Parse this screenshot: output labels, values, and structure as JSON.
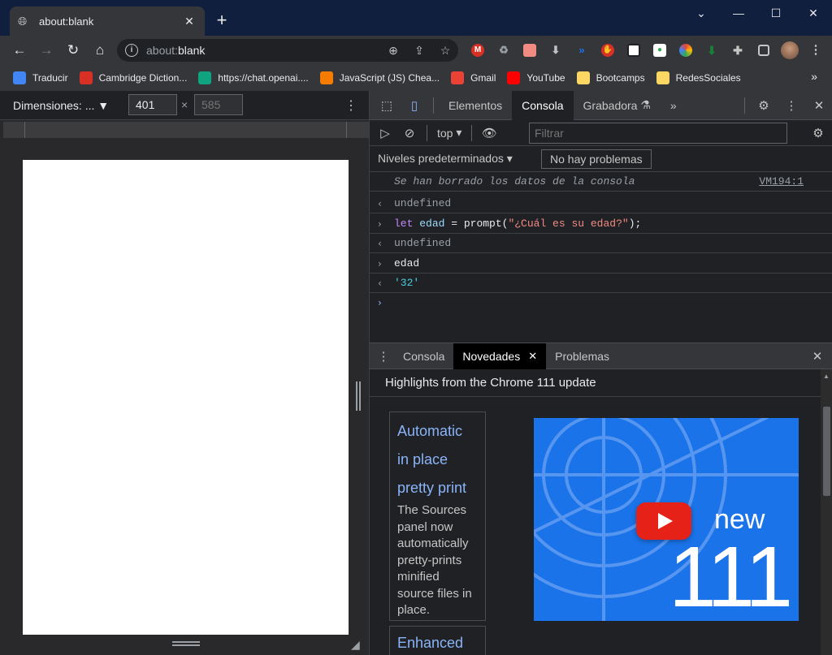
{
  "browser": {
    "tab": {
      "title": "about:blank"
    },
    "omnibox": {
      "url_prefix": "about:",
      "url_host": "blank"
    },
    "bookmarks": [
      {
        "label": "Traducir",
        "icon": "google-translate-icon",
        "color": "#4285f4"
      },
      {
        "label": "Cambridge Diction...",
        "icon": "cambridge-icon",
        "color": "#d93025"
      },
      {
        "label": "https://chat.openai....",
        "icon": "openai-icon",
        "color": "#10a37f"
      },
      {
        "label": "JavaScript (JS) Chea...",
        "icon": "js-cheatsheet-icon",
        "color": "#f57c00"
      },
      {
        "label": "Gmail",
        "icon": "gmail-icon",
        "color": "#ea4335"
      },
      {
        "label": "YouTube",
        "icon": "youtube-icon",
        "color": "#ff0000"
      },
      {
        "label": "Bootcamps",
        "icon": "folder-icon",
        "color": "#fdd663"
      },
      {
        "label": "RedesSociales",
        "icon": "folder-icon",
        "color": "#fdd663"
      }
    ]
  },
  "device_toolbar": {
    "dimensions_label": "Dimensiones: ...",
    "width": "401",
    "height_placeholder": "585",
    "times": "×"
  },
  "devtools": {
    "tabs": [
      "Elementos",
      "Consola",
      "Grabadora"
    ],
    "active_tab": "Consola",
    "context": "top",
    "filter_placeholder": "Filtrar",
    "levels_label": "Niveles predeterminados",
    "issues_label": "No hay problemas",
    "console": {
      "cleared_msg": "Se han borrado los datos de la consola",
      "cleared_src": "VM194:1",
      "undefined1": "undefined",
      "cmd_let": "let",
      "cmd_var": "edad",
      "cmd_eq": " = prompt(",
      "cmd_str": "\"¿Cuál es su edad?\"",
      "cmd_end": ");",
      "undefined2": "undefined",
      "cmd2": "edad",
      "result2": "'32'"
    },
    "drawer": {
      "tabs": [
        "Consola",
        "Novedades",
        "Problemas"
      ],
      "active_tab": "Novedades",
      "heading": "Highlights from the Chrome 111 update",
      "card1_title_lines": [
        "Automatic",
        "in place",
        "pretty print"
      ],
      "card1_body": "The Sources panel now automatically pretty-prints minified source files in place.",
      "card2_title": "Enhanced",
      "video_word": "new",
      "video_number": "111"
    }
  }
}
